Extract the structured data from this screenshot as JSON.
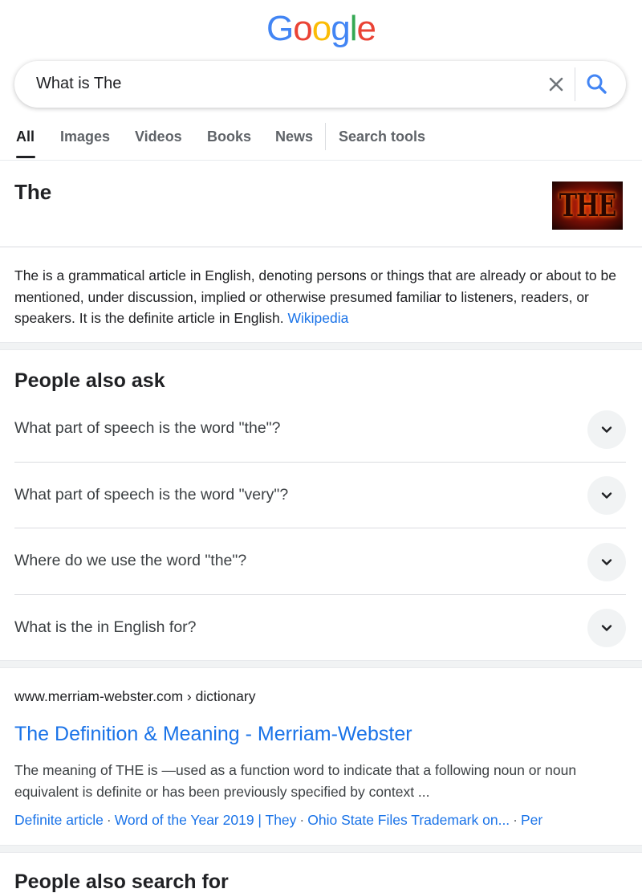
{
  "logo": {
    "letters": [
      "G",
      "o",
      "o",
      "g",
      "l",
      "e"
    ]
  },
  "search": {
    "query": "What is The"
  },
  "tabs": [
    {
      "label": "All",
      "active": true
    },
    {
      "label": "Images"
    },
    {
      "label": "Videos"
    },
    {
      "label": "Books"
    },
    {
      "label": "News"
    },
    {
      "label": "Search tools"
    }
  ],
  "entity": {
    "title": "The",
    "image_text": "THE",
    "description": "The is a grammatical article in English, denoting persons or things that are already or about to be mentioned, under discussion, implied or otherwise presumed familiar to listeners, readers, or speakers. It is the definite article in English.",
    "source": "Wikipedia"
  },
  "people_also_ask": {
    "title": "People also ask",
    "questions": [
      "What part of speech is the word \"the\"?",
      "What part of speech is the word \"very\"?",
      "Where do we use the word \"the\"?",
      "What is the in English for?"
    ]
  },
  "result": {
    "url": "www.merriam-webster.com › dictionary",
    "title": "The Definition & Meaning - Merriam-Webster",
    "snippet": "The meaning of THE is —used as a function word to indicate that a following noun or noun equivalent is definite or has been previously specified by context ...",
    "sitelinks": [
      "Definite article",
      "Word of the Year 2019 | They",
      "Ohio State Files Trademark on...",
      "Per"
    ]
  },
  "people_also_search_for": {
    "title": "People also search for"
  },
  "colors": {
    "blue": "#4285f4",
    "red": "#ea4335",
    "yellow": "#fbbc05",
    "green": "#34a853",
    "link": "#1a73e8"
  }
}
